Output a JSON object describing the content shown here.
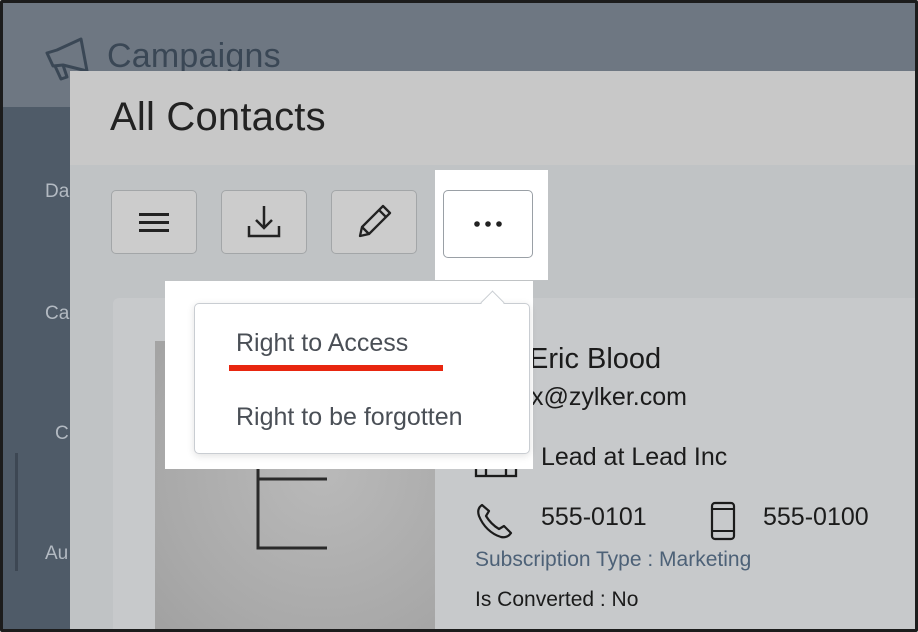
{
  "app": {
    "title": "Campaigns"
  },
  "sidebar": {
    "items": [
      {
        "label": "Da"
      },
      {
        "label": "Ca"
      },
      {
        "label": "C"
      },
      {
        "label": "Au"
      }
    ]
  },
  "modal": {
    "title": "All Contacts",
    "toolbar": [
      {
        "icon": "menu-icon"
      },
      {
        "icon": "download-icon"
      },
      {
        "icon": "pencil-icon"
      },
      {
        "icon": "more-icon"
      }
    ]
  },
  "dropdown": {
    "items": [
      {
        "label": "Right to Access"
      },
      {
        "label": "Right to be forgotten"
      }
    ]
  },
  "contact": {
    "avatar_letter": "E",
    "name": "Eric Blood",
    "email": "x@zylker.com",
    "company": "Lead at Lead Inc",
    "phone": "555-0101",
    "mobile": "555-0100",
    "subscription": "Subscription Type : Marketing",
    "is_converted": "Is Converted : No"
  },
  "colors": {
    "highlight": "#e8260f",
    "link": "#4d6177"
  }
}
